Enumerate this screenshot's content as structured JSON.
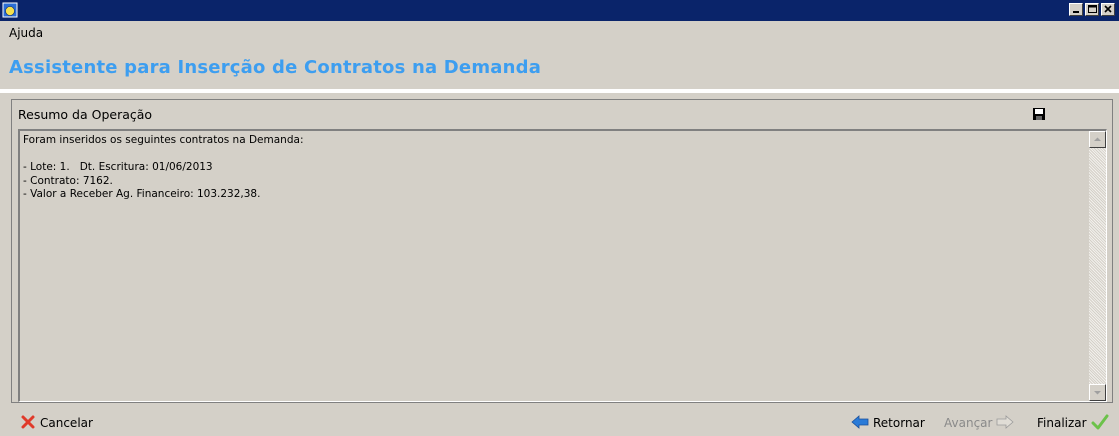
{
  "menu": {
    "help": "Ajuda"
  },
  "wizard": {
    "title": "Assistente para Inserção de Contratos na Demanda"
  },
  "summary": {
    "header": "Resumo da Operação",
    "text": "Foram inseridos os seguintes contratos na Demanda:\n\n- Lote: 1.   Dt. Escritura: 01/06/2013\n- Contrato: 7162.\n- Valor a Receber Ag. Financeiro: 103.232,38."
  },
  "buttons": {
    "cancel": "Cancelar",
    "back": "Retornar",
    "next": "Avançar",
    "finish": "Finalizar"
  },
  "colors": {
    "titlebar": "#0a246a",
    "wizard_title": "#3d9ef0",
    "cancel_icon": "#e03a2a",
    "back_icon": "#2a7bd8",
    "finish_icon": "#6cc24a"
  }
}
